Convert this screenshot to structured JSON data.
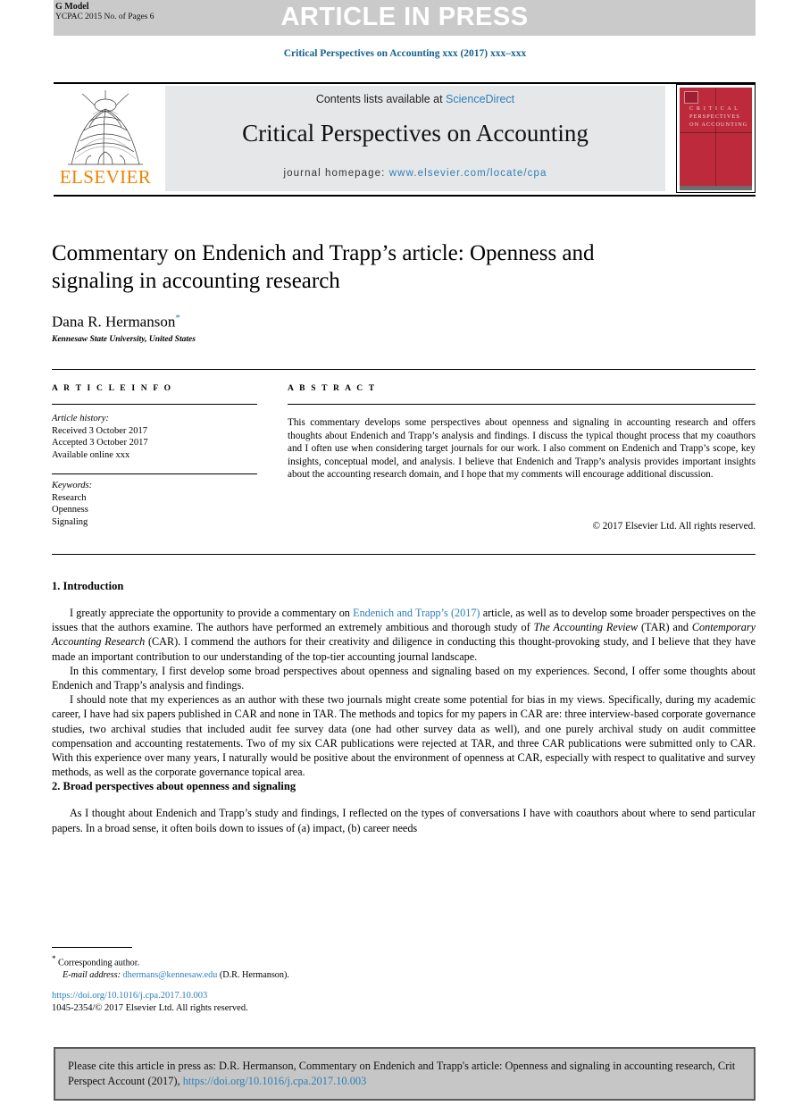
{
  "banner": {
    "aip_text": "ARTICLE IN PRESS",
    "g_model": "G Model",
    "manuscript_id": "YCPAC 2015 No. of Pages 6",
    "banner_color": "#cacaca"
  },
  "journal_line": "Critical Perspectives on Accounting xxx (2017) xxx–xxx",
  "masthead": {
    "contents_prefix": "Contents lists available at ",
    "sciencedirect": "ScienceDirect",
    "journal_title": "Critical Perspectives on Accounting",
    "homepage_label": "journal homepage: ",
    "homepage_url": "www.elsevier.com/locate/cpa",
    "publisher": "ELSEVIER",
    "publisher_color": "#ef8200",
    "link_color": "#2d7fb8",
    "cover_title": "C R I T I C A L PERSPECTIVES ON ACCOUNTING",
    "cover_color": "#bc2a3c"
  },
  "article": {
    "title": "Commentary on Endenich and Trapp’s article: Openness and signaling in accounting research",
    "author": "Dana R. Hermanson",
    "author_marker": "*",
    "affiliation": "Kennesaw State University, United States"
  },
  "info": {
    "heading": "A R T I C L E   I N F O",
    "history_label": "Article history:",
    "history": [
      "Received 3 October 2017",
      "Accepted 3 October 2017",
      "Available online xxx"
    ],
    "keywords_label": "Keywords:",
    "keywords": [
      "Research",
      "Openness",
      "Signaling"
    ]
  },
  "abstract": {
    "heading": "A B S T R A C T",
    "text": "This commentary develops some perspectives about openness and signaling in accounting research and offers thoughts about Endenich and Trapp’s analysis and findings. I discuss the typical thought process that my coauthors and I often use when considering target journals for our work. I also comment on Endenich and Trapp’s scope, key insights, conceptual model, and analysis. I believe that Endenich and Trapp’s analysis provides important insights about the accounting research domain, and I hope that my comments will encourage additional discussion.",
    "copyright": "© 2017 Elsevier Ltd. All rights reserved."
  },
  "body": {
    "section1_heading": "1. Introduction",
    "p1_a": "I greatly appreciate the opportunity to provide a commentary on ",
    "p1_link": "Endenich and Trapp’s (2017)",
    "p1_b": " article, as well as to develop some broader perspectives on the issues that the authors examine. The authors have performed an extremely ambitious and thorough study of ",
    "p1_ital1": "The Accounting Review",
    "p1_c": " (TAR) and ",
    "p1_ital2": "Contemporary Accounting Research",
    "p1_d": " (CAR). I commend the authors for their creativity and diligence in conducting this thought-provoking study, and I believe that they have made an important contribution to our understanding of the top-tier accounting journal landscape.",
    "p2": "In this commentary, I first develop some broad perspectives about openness and signaling based on my experiences. Second, I offer some thoughts about Endenich and Trapp’s analysis and findings.",
    "p3": "I should note that my experiences as an author with these two journals might create some potential for bias in my views. Specifically, during my academic career, I have had six papers published in CAR and none in TAR. The methods and topics for my papers in CAR are: three interview-based corporate governance studies, two archival studies that included audit fee survey data (one had other survey data as well), and one purely archival study on audit committee compensation and accounting restatements. Two of my six CAR publications were rejected at TAR, and three CAR publications were submitted only to CAR. With this experience over many years, I naturally would be positive about the environment of openness at CAR, especially with respect to qualitative and survey methods, as well as the corporate governance topical area.",
    "section2_heading": "2. Broad perspectives about openness and signaling",
    "p4": "As I thought about Endenich and Trapp’s study and findings, I reflected on the types of conversations I have with coauthors about where to send particular papers. In a broad sense, it often boils down to issues of (a) impact, (b) career needs"
  },
  "footer": {
    "corresponding_marker": "*",
    "corresponding_author": " Corresponding author.",
    "email_label": "E-mail address:",
    "email": "dhermans@kennesaw.edu",
    "email_suffix": " (D.R. Hermanson).",
    "doi": "https://doi.org/10.1016/j.cpa.2017.10.003",
    "issn_line": "1045-2354/© 2017 Elsevier Ltd. All rights reserved."
  },
  "cite_box": {
    "text_a": "Please cite this article in press as: D.R. Hermanson, Commentary on Endenich and Trapp's article: Openness and signaling in accounting research, Crit Perspect Account (2017), ",
    "link": "https://doi.org/10.1016/j.cpa.2017.10.003"
  }
}
